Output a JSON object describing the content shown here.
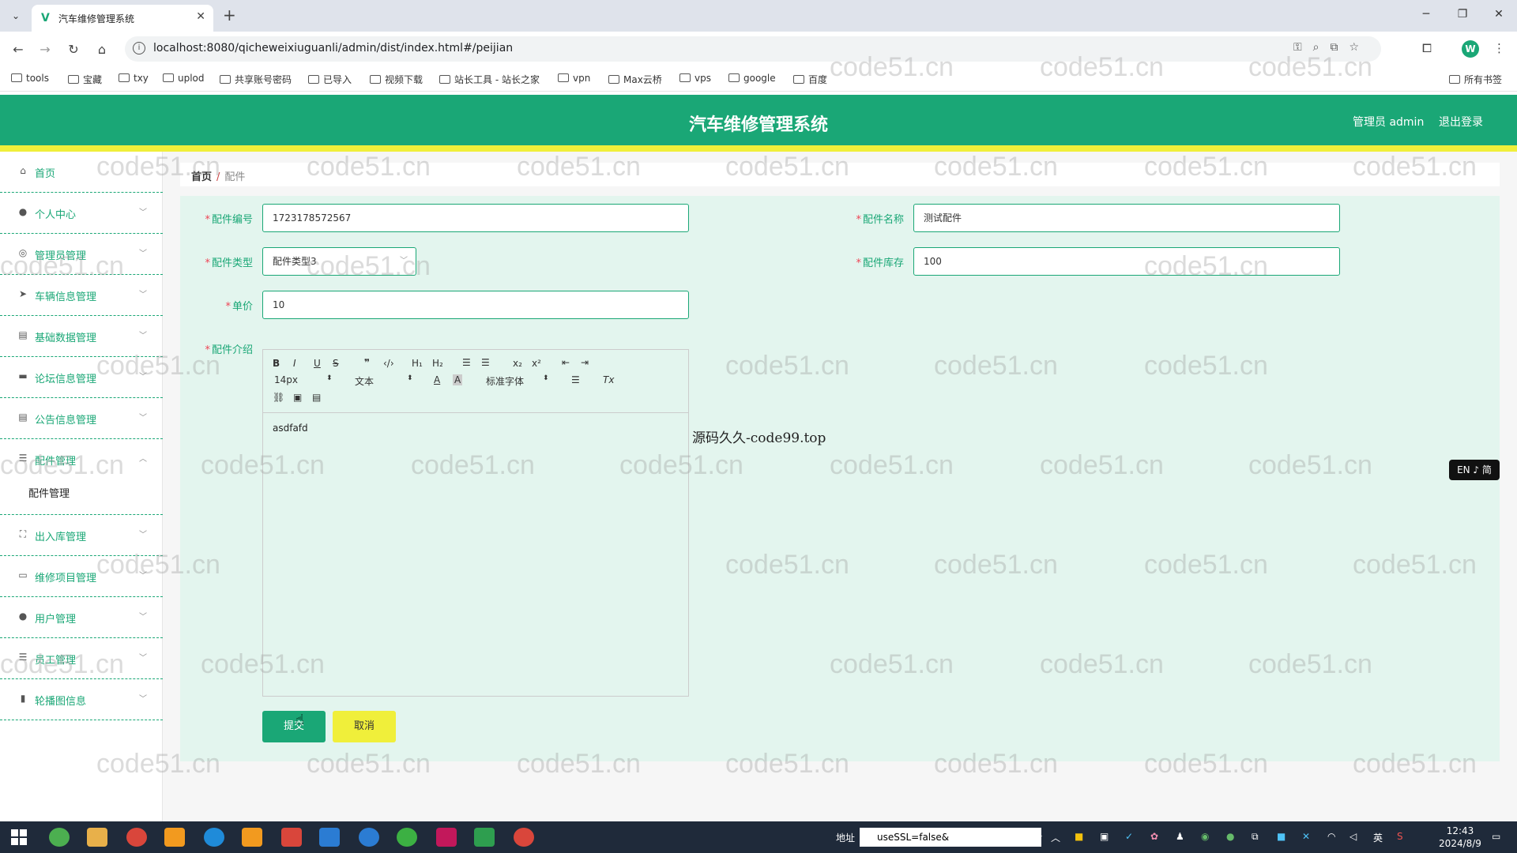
{
  "browser": {
    "tab_title": "汽车维修管理系统",
    "url": "localhost:8080/qicheweixiuguanli/admin/dist/index.html#/peijian",
    "profile_initial": "W",
    "bookmarks": [
      "tools",
      "宝藏",
      "txy",
      "uplod",
      "共享账号密码",
      "已导入",
      "视频下载",
      "站长工具 - 站长之家",
      "vpn",
      "Max云桥",
      "vps",
      "google",
      "百度"
    ],
    "all_bookmarks": "所有书签"
  },
  "app": {
    "title": "汽车维修管理系统",
    "user": "管理员 admin",
    "logout": "退出登录",
    "colors": {
      "primary": "#1aa776",
      "accent_yellow": "#f0ef3a",
      "panel": "#e3f5ee"
    }
  },
  "sidebar": {
    "items": [
      {
        "label": "首页",
        "icon": "home-icon"
      },
      {
        "label": "个人中心",
        "icon": "user-icon"
      },
      {
        "label": "管理员管理",
        "icon": "admin-icon"
      },
      {
        "label": "车辆信息管理",
        "icon": "nav-icon"
      },
      {
        "label": "基础数据管理",
        "icon": "clipboard-icon"
      },
      {
        "label": "论坛信息管理",
        "icon": "chat-icon"
      },
      {
        "label": "公告信息管理",
        "icon": "notice-icon"
      },
      {
        "label": "配件管理",
        "icon": "sliders-icon"
      },
      {
        "label": "出入库管理",
        "icon": "fullscreen-icon"
      },
      {
        "label": "维修项目管理",
        "icon": "folder-icon"
      },
      {
        "label": "用户管理",
        "icon": "user-icon"
      },
      {
        "label": "员工管理",
        "icon": "list-icon"
      },
      {
        "label": "轮播图信息",
        "icon": "bar-chart-icon"
      }
    ],
    "submenu": "配件管理"
  },
  "breadcrumb": {
    "home": "首页",
    "sep": "/",
    "current": "配件"
  },
  "form": {
    "part_no_label": "配件编号",
    "part_no_value": "1723178572567",
    "part_name_label": "配件名称",
    "part_name_value": "测试配件",
    "part_type_label": "配件类型",
    "part_type_value": "配件类型3",
    "stock_label": "配件库存",
    "stock_value": "100",
    "price_label": "单价",
    "price_value": "10",
    "intro_label": "配件介绍",
    "intro_value": "asdfafd",
    "editor_font_size": "14px",
    "editor_header": "文本",
    "editor_font": "标准字体",
    "submit": "提交",
    "cancel": "取消"
  },
  "note": "源码久久-code99.top",
  "lang_pill": "EN ♪ 简",
  "watermark": "code51.cn",
  "taskbar": {
    "addr_label": "地址",
    "addr_value": "useSSL=false&",
    "ime": "英",
    "time": "12:43",
    "date": "2024/8/9"
  }
}
